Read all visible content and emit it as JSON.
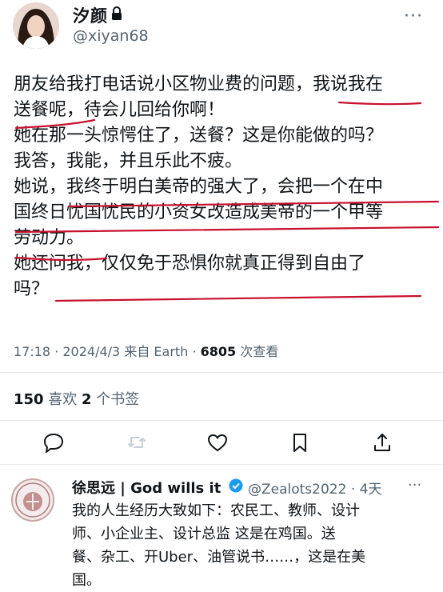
{
  "tweet": {
    "author_name": "汐颜",
    "author_handle": "@xiyan68",
    "more_icon": "more-icon",
    "lines": [
      "朋友给我打电话说小区物业费的问题，我说我在",
      "送餐呢，待会儿回给你啊！",
      "她在那一头惊愕住了，送餐？这是你能做的吗？",
      "我答，我能，并且乐此不疲。",
      "她说，我终于明白美帝的强大了，会把一个在中",
      "国终日忧国忧民的小资女改造成美帝的一个甲等",
      "劳动力。",
      "她还问我，仅仅免于恐惧你就真正得到自由了",
      "吗？"
    ],
    "time": "17:18 · 2024/4/3 来自 Earth · ",
    "views": "6805",
    "views_label": " 次查看",
    "likes": "150",
    "likes_label": " 喜欢  ",
    "bookmarks": "2",
    "bookmarks_label": " 个书签"
  },
  "actions": [
    "reply-icon",
    "retweet-icon",
    "like-icon",
    "bookmark-icon",
    "share-icon"
  ],
  "reply": {
    "author_name": "徐思远 | God wills it",
    "author_handle": "@Zealots2022 · 4天",
    "more": "···",
    "lines": [
      "我的人生经历大致如下：农民工、教师、设计",
      "师、小企业主、设计总监      这是在鸡国。送",
      "餐、杂工、开Uber、油管说书……，这是在美",
      "国。"
    ]
  },
  "colors": {
    "underline": "#c8102e",
    "verified": "#1d9bf0"
  }
}
